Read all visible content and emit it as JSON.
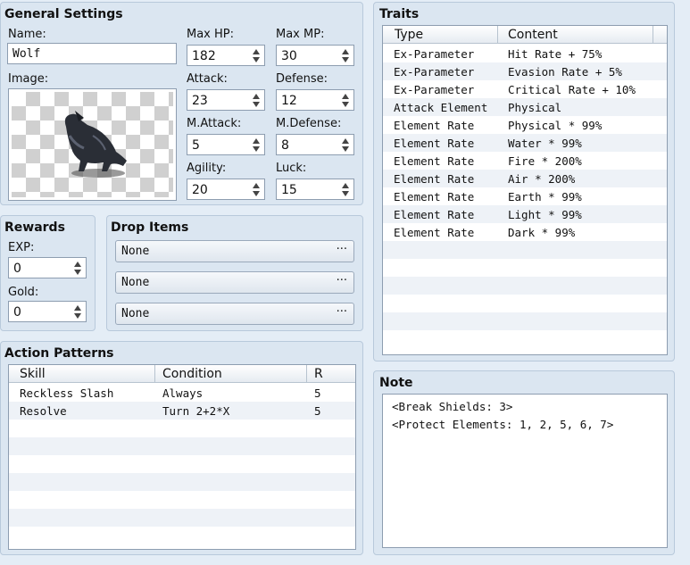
{
  "general": {
    "title": "General Settings",
    "name_label": "Name:",
    "name_value": "Wolf",
    "image_label": "Image:",
    "max_hp_label": "Max HP:",
    "max_hp": "182",
    "max_mp_label": "Max MP:",
    "max_mp": "30",
    "attack_label": "Attack:",
    "attack": "23",
    "defense_label": "Defense:",
    "defense": "12",
    "mattack_label": "M.Attack:",
    "mattack": "5",
    "mdefense_label": "M.Defense:",
    "mdefense": "8",
    "agility_label": "Agility:",
    "agility": "20",
    "luck_label": "Luck:",
    "luck": "15"
  },
  "rewards": {
    "title": "Rewards",
    "exp_label": "EXP:",
    "exp": "0",
    "gold_label": "Gold:",
    "gold": "0"
  },
  "drops": {
    "title": "Drop Items",
    "items": [
      "None",
      "None",
      "None"
    ],
    "dots": "···"
  },
  "actions": {
    "title": "Action Patterns",
    "headers": [
      "Skill",
      "Condition",
      "R"
    ],
    "rows": [
      [
        "Reckless Slash",
        "Always",
        "5"
      ],
      [
        "Resolve",
        "Turn 2+2*X",
        "5"
      ]
    ]
  },
  "traits": {
    "title": "Traits",
    "headers": [
      "Type",
      "Content"
    ],
    "rows": [
      [
        "Ex-Parameter",
        "Hit Rate + 75%"
      ],
      [
        "Ex-Parameter",
        "Evasion Rate + 5%"
      ],
      [
        "Ex-Parameter",
        "Critical Rate + 10%"
      ],
      [
        "Attack Element",
        "Physical"
      ],
      [
        "Element Rate",
        "Physical * 99%"
      ],
      [
        "Element Rate",
        "Water * 99%"
      ],
      [
        "Element Rate",
        "Fire * 200%"
      ],
      [
        "Element Rate",
        "Air * 200%"
      ],
      [
        "Element Rate",
        "Earth * 99%"
      ],
      [
        "Element Rate",
        "Light * 99%"
      ],
      [
        "Element Rate",
        "Dark * 99%"
      ]
    ]
  },
  "note": {
    "title": "Note",
    "lines": [
      "<Break Shields: 3>",
      "<Protect Elements: 1, 2, 5, 6, 7>"
    ]
  }
}
